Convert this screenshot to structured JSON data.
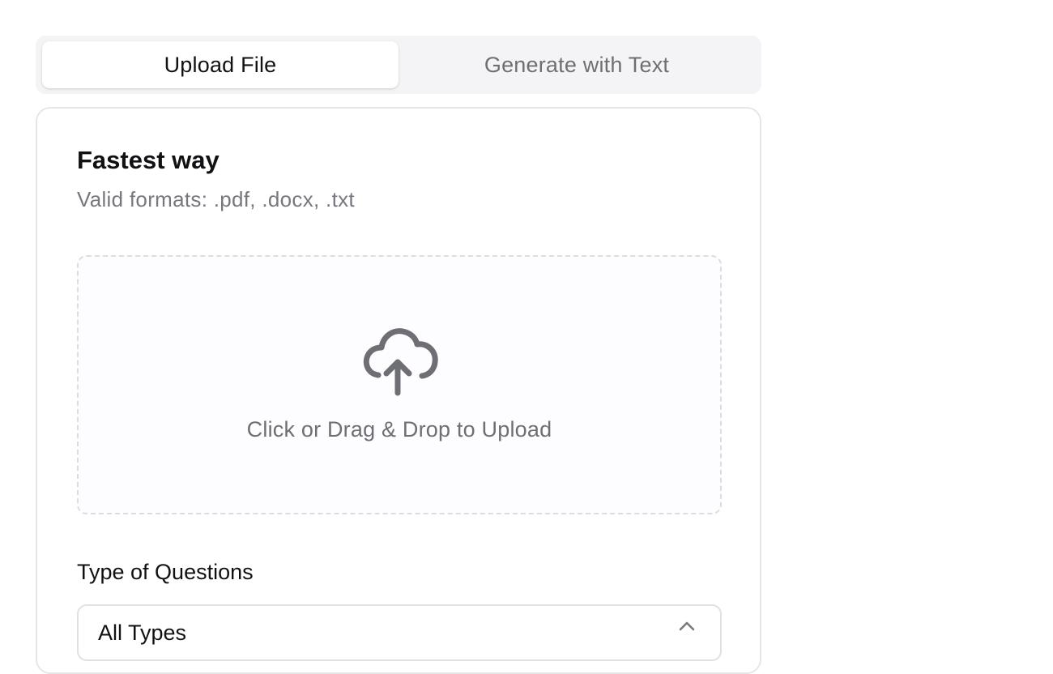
{
  "tabs": [
    {
      "label": "Upload File",
      "active": true
    },
    {
      "label": "Generate with Text",
      "active": false
    }
  ],
  "card": {
    "title": "Fastest way",
    "subtitle": "Valid formats: .pdf, .docx, .txt"
  },
  "dropzone": {
    "icon": "cloud-upload-icon",
    "text": "Click or Drag & Drop to Upload"
  },
  "question_type": {
    "label": "Type of Questions",
    "selected": "All Types",
    "chevron_icon": "chevron-up-icon"
  },
  "colors": {
    "text_primary": "#111114",
    "text_muted": "#6e6e75",
    "tab_track": "#f4f4f6",
    "border": "#e6e6ea"
  }
}
